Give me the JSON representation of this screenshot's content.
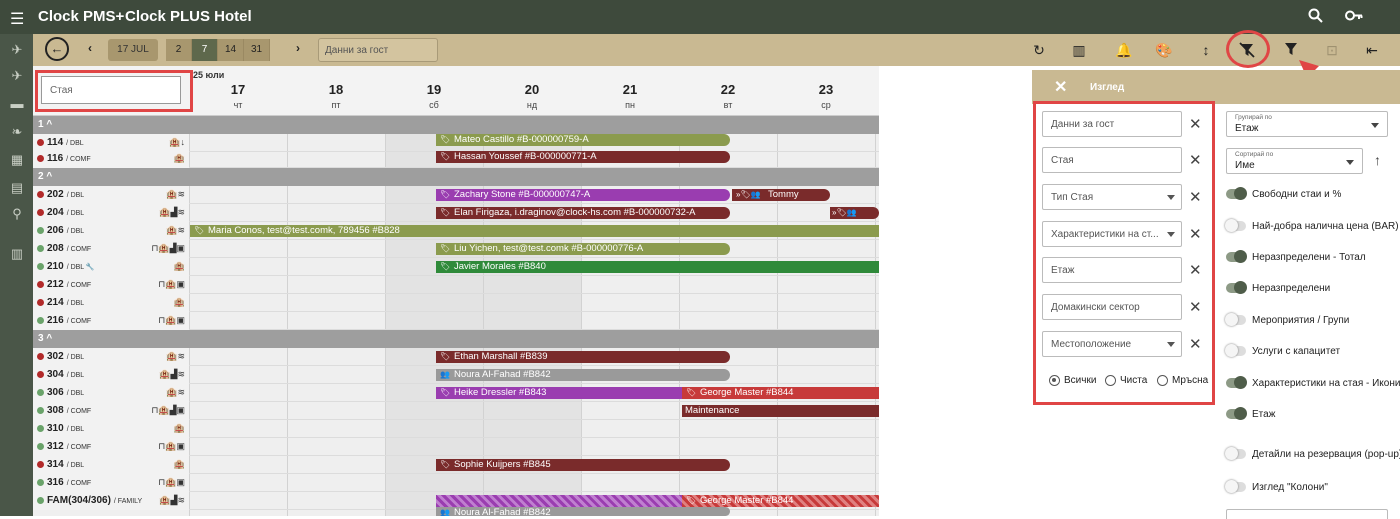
{
  "app": {
    "name": "Clock PMS+",
    "hotel": "Clock PLUS Hotel"
  },
  "toolbar": {
    "date": "17 JUL",
    "range_options": [
      "2",
      "7",
      "14",
      "31"
    ],
    "active_range": "7",
    "guest_placeholder": "Данни за гост"
  },
  "grid": {
    "month_label": "25 юли",
    "room_filter_placeholder": "Стая",
    "days": [
      {
        "n": "17",
        "w": "чт"
      },
      {
        "n": "18",
        "w": "пт"
      },
      {
        "n": "19",
        "w": "сб"
      },
      {
        "n": "20",
        "w": "нд"
      },
      {
        "n": "21",
        "w": "пн"
      },
      {
        "n": "22",
        "w": "вт"
      },
      {
        "n": "23",
        "w": "ср"
      }
    ],
    "floors": [
      {
        "label": "1 ^"
      },
      {
        "label": "2 ^"
      },
      {
        "label": "3 ^"
      }
    ],
    "rooms": [
      {
        "num": "114",
        "type": "/ DBL",
        "icons": "🏨↓"
      },
      {
        "num": "116",
        "type": "/ COMF",
        "icons": "🏨"
      },
      {
        "num": "202",
        "type": "/ DBL",
        "icons": "🏨≋"
      },
      {
        "num": "204",
        "type": "/ DBL",
        "icons": "🏨▟≋"
      },
      {
        "num": "206",
        "type": "/ DBL",
        "icons": "🏨≋"
      },
      {
        "num": "208",
        "type": "/ COMF",
        "icons": "⊓🏨▟▣"
      },
      {
        "num": "210",
        "type": "/ DBL 🔧",
        "icons": "🏨"
      },
      {
        "num": "212",
        "type": "/ COMF",
        "icons": "⊓🏨▣"
      },
      {
        "num": "214",
        "type": "/ DBL",
        "icons": "🏨"
      },
      {
        "num": "216",
        "type": "/ COMF",
        "icons": "⊓🏨▣"
      },
      {
        "num": "302",
        "type": "/ DBL",
        "icons": "🏨≋"
      },
      {
        "num": "304",
        "type": "/ DBL",
        "icons": "🏨▟≋"
      },
      {
        "num": "306",
        "type": "/ DBL",
        "icons": "🏨≋"
      },
      {
        "num": "308",
        "type": "/ COMF",
        "icons": "⊓🏨▟▣"
      },
      {
        "num": "310",
        "type": "/ DBL",
        "icons": "🏨"
      },
      {
        "num": "312",
        "type": "/ COMF",
        "icons": "⊓🏨▣"
      },
      {
        "num": "314",
        "type": "/ DBL",
        "icons": "🏨"
      },
      {
        "num": "316",
        "type": "/ COMF",
        "icons": "⊓🏨▣"
      },
      {
        "num": "FAM(304/306)",
        "type": "/ FAMILY",
        "icons": "🏨▟≋"
      }
    ],
    "bookings": [
      {
        "label": "Mateo Castillo #B-000000759-A"
      },
      {
        "label": "Hassan Youssef #B-000000771-A"
      },
      {
        "label": "Zachary Stone #B-000000747-A"
      },
      {
        "label": "Tommy"
      },
      {
        "label": "Elan Firigaza, i.draginov@clock-hs.com #B-000000732-A"
      },
      {
        "label": "Maria Conos, test@test.comk, 789456 #B828"
      },
      {
        "label": "Liu Yichen, test@test.comk #B-000000776-A"
      },
      {
        "label": "Javier Morales #B840"
      },
      {
        "label": "Ethan Marshall #B839"
      },
      {
        "label": "Noura Al-Fahad #B842"
      },
      {
        "label": "Heike Dressler #B843"
      },
      {
        "label": "George Master #B844"
      },
      {
        "label": "Maintenance"
      },
      {
        "label": "Sophie Kuijpers #B845"
      },
      {
        "label": "George Master #B844"
      },
      {
        "label": "Noura Al-Fahad #B842"
      }
    ]
  },
  "panel": {
    "title": "Изглед",
    "filters": [
      "Данни за гост",
      "Стая",
      "Тип Стая",
      "Характеристики на ст...",
      "Етаж",
      "Домакински сектор",
      "Местоположение"
    ],
    "radios": [
      "Всички",
      "Чиста",
      "Мръсна"
    ],
    "group_by": {
      "label": "Групирай по",
      "value": "Етаж"
    },
    "sort_by": {
      "label": "Сортирай по",
      "value": "Име"
    },
    "toggles": [
      {
        "label": "Свободни стаи и %",
        "on": true
      },
      {
        "label": "Най-добра налична цена (BAR)",
        "on": false
      },
      {
        "label": "Неразпределени - Тотал",
        "on": true
      },
      {
        "label": "Неразпределени",
        "on": true
      },
      {
        "label": "Мероприятия / Групи",
        "on": false
      },
      {
        "label": "Услуги с капацитет",
        "on": false
      },
      {
        "label": "Характеристики на стая - Икони",
        "on": true
      },
      {
        "label": "Етаж",
        "on": true
      },
      {
        "label": "Детайли на резервация (pop-up)",
        "on": false
      },
      {
        "label": "Изглед \"Колони\"",
        "on": false
      }
    ]
  }
}
